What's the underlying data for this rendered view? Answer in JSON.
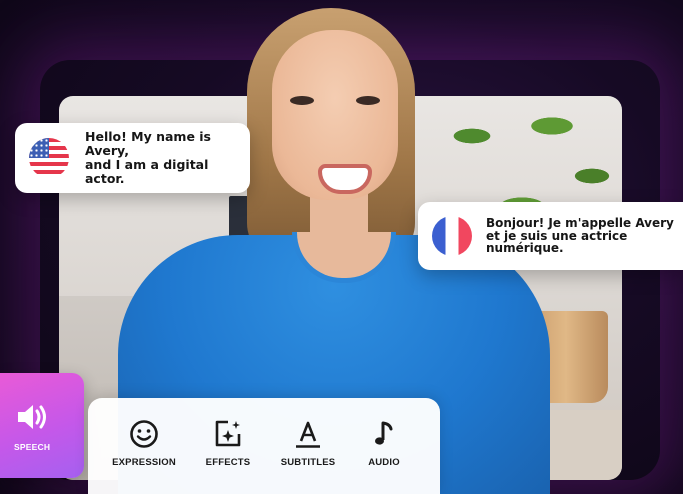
{
  "bubbles": {
    "english": {
      "flag_icon": "us-flag-icon",
      "text": "Hello! My name is Avery,\nand I am a digital actor."
    },
    "french": {
      "flag_icon": "france-flag-icon",
      "text": "Bonjour! Je m'appelle Avery\net je suis une actrice\nnumérique."
    }
  },
  "speech": {
    "label": "SPEECH",
    "icon": "speaker-icon"
  },
  "toolbar": {
    "items": [
      {
        "label": "EXPRESSION",
        "icon": "smiley-face-icon"
      },
      {
        "label": "EFFECTS",
        "icon": "sparkle-effects-icon"
      },
      {
        "label": "SUBTITLES",
        "icon": "text-underline-icon"
      },
      {
        "label": "AUDIO",
        "icon": "music-note-icon"
      }
    ]
  },
  "colors": {
    "background": "#160a24",
    "speech_gradient_start": "#e95ad7",
    "speech_gradient_end": "#a560f0",
    "shirt": "#1f78cf",
    "icon_dark": "#1a1a1a"
  }
}
